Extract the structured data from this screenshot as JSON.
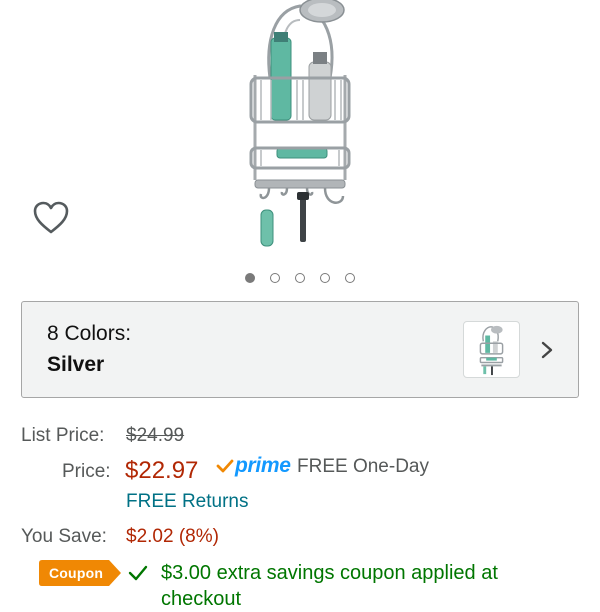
{
  "product": {
    "image_icon": "shower-caddy-image",
    "wishlist_icon": "heart-icon",
    "carousel": {
      "count": 5,
      "active_index": 1
    }
  },
  "color_selector": {
    "title": "8 Colors:",
    "selected": "Silver",
    "thumbnail_icon": "shower-caddy-thumbnail",
    "chevron_icon": "chevron-right-icon"
  },
  "pricing": {
    "list_price_label": "List Price:",
    "list_price": "$24.99",
    "price_label": "Price:",
    "price": "$22.97",
    "prime_label": "prime",
    "shipping": "FREE One-Day",
    "returns": "FREE Returns",
    "save_label": "You Save:",
    "save_value": "$2.02 (8%)"
  },
  "coupon": {
    "badge": "Coupon",
    "text": "$3.00 extra savings coupon applied at checkout"
  },
  "colors": {
    "price_red": "#b12704",
    "link_teal": "#007185",
    "prime_blue": "#1399ff",
    "coupon_orange": "#f08804",
    "coupon_green": "#007600"
  }
}
